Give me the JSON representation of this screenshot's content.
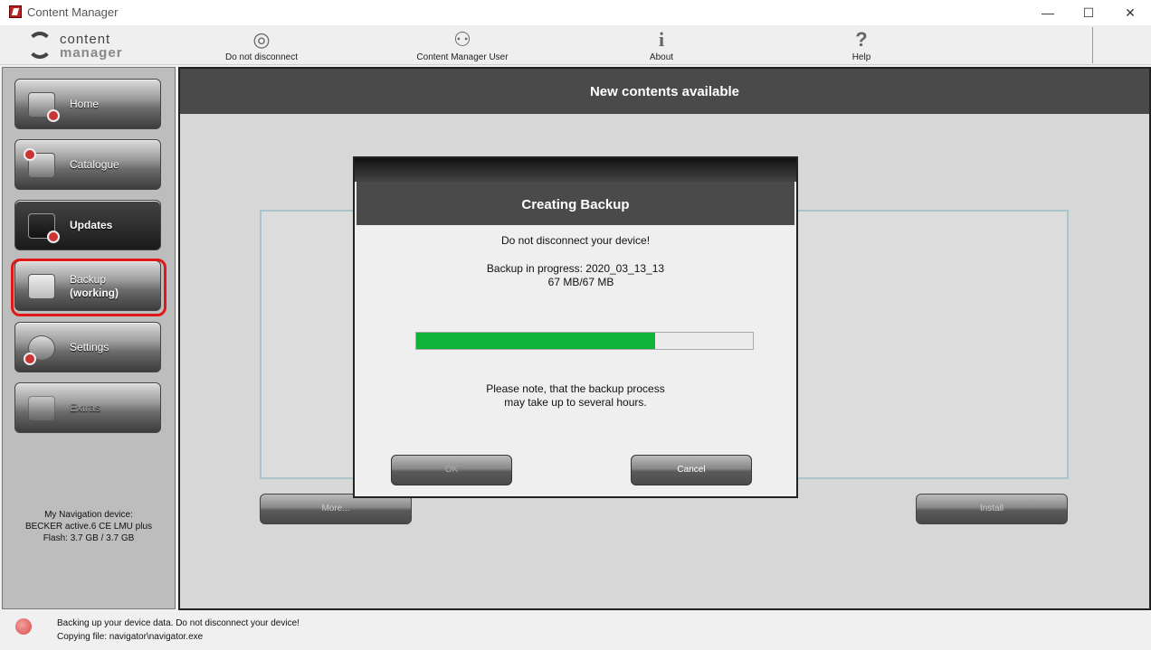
{
  "window": {
    "title": "Content Manager",
    "controls": {
      "minimize": "—",
      "maximize": "☐",
      "close": "✕"
    }
  },
  "logo": {
    "line1": "content",
    "line2": "manager"
  },
  "toolbar": {
    "items": [
      {
        "label": "Do not disconnect",
        "icon": "disconnect-icon",
        "glyph": "◎"
      },
      {
        "label": "Content Manager User",
        "icon": "user-icon",
        "glyph": "⚇"
      },
      {
        "label": "About",
        "icon": "info-icon",
        "glyph": "i"
      },
      {
        "label": "Help",
        "icon": "help-icon",
        "glyph": "?"
      }
    ]
  },
  "sidebar": {
    "items": [
      {
        "label": "Home",
        "icon": "home-icon"
      },
      {
        "label": "Catalogue",
        "icon": "catalogue-icon"
      },
      {
        "label": "Updates",
        "icon": "updates-icon"
      },
      {
        "label": "Backup",
        "sublabel": "(working)",
        "icon": "floppy-disk-icon"
      },
      {
        "label": "Settings",
        "icon": "settings-gear-icon"
      },
      {
        "label": "Extras",
        "icon": "extras-star-icon"
      }
    ],
    "device": {
      "line1": "My Navigation device:",
      "line2": "BECKER active.6 CE LMU plus",
      "line3": "Flash: 3.7 GB / 3.7 GB"
    }
  },
  "main": {
    "header": "New contents available",
    "more_button": "More...",
    "install_button": "Install"
  },
  "dialog": {
    "title": "Creating Backup",
    "warning": "Do not disconnect your device!",
    "progress_label": "Backup in progress: 2020_03_13_13",
    "progress_size": "67 MB/67 MB",
    "progress_fraction": 0.71,
    "note_line1": "Please note, that the backup process",
    "note_line2": "may take up to several hours.",
    "ok_button": "OK",
    "cancel_button": "Cancel"
  },
  "status": {
    "line1": "Backing up your device data. Do not disconnect your device!",
    "line2": "Copying file:  navigator\\navigator.exe"
  },
  "colors": {
    "progress_fill": "#11b33a",
    "highlight_ring": "#e01818",
    "header_bg": "#4a4a4a"
  }
}
